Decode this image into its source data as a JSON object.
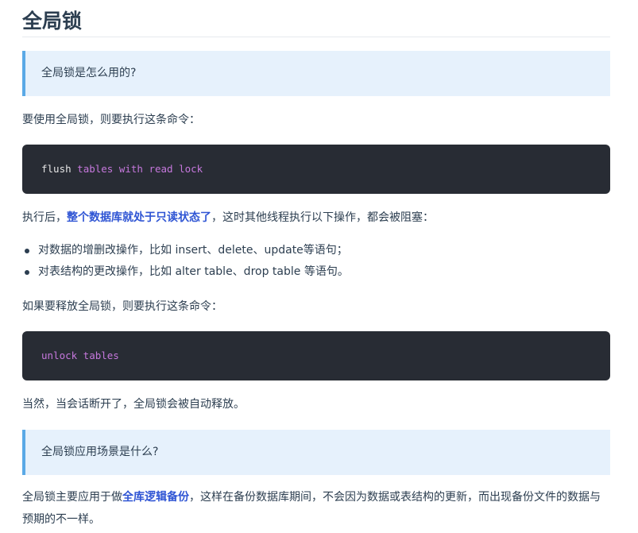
{
  "doc": {
    "title": "全局锁",
    "callout1": "全局锁是怎么用的?",
    "p1": "要使用全局锁，则要执行这条命令：",
    "code1": {
      "word1": "flush",
      "rest": " tables with read lock"
    },
    "p2": {
      "before": "执行后，",
      "highlight": "整个数据库就处于只读状态了",
      "after": "，这时其他线程执行以下操作，都会被阻塞："
    },
    "bullets": [
      "对数据的增删改操作，比如 insert、delete、update等语句；",
      "对表结构的更改操作，比如 alter table、drop table 等语句。"
    ],
    "p3": "如果要释放全局锁，则要执行这条命令：",
    "code2": "unlock tables",
    "p4": "当然，当会话断开了，全局锁会被自动释放。",
    "callout2": "全局锁应用场景是什么?",
    "p5": {
      "before": "全局锁主要应用于做",
      "highlight": "全库逻辑备份",
      "after": "，这样在备份数据库期间，不会因为数据或表结构的更新，而出现备份文件的数据与预期的不一样。"
    }
  }
}
